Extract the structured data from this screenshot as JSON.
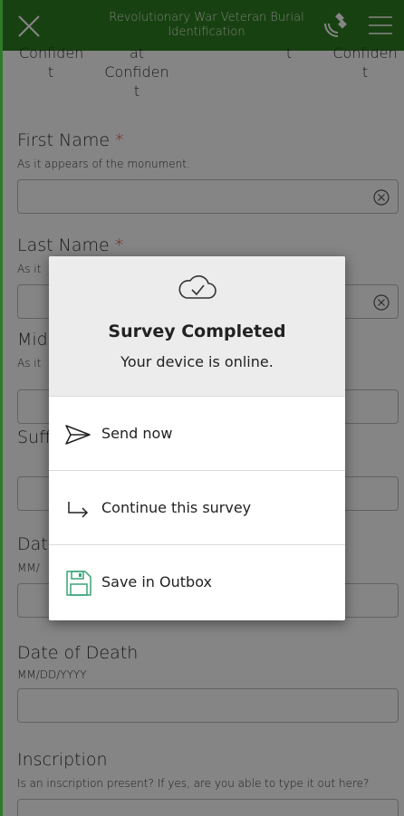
{
  "header": {
    "title_line1": "Revolutionary War Veteran Burial",
    "title_line2": "Identification"
  },
  "form": {
    "choices": {
      "c1_line1": "Confiden",
      "c1_line2": "t",
      "c2_line1": "at",
      "c2_line2": "Confiden",
      "c2_line3": "t",
      "c3_line1": "t",
      "c4_line1": "Confiden",
      "c4_line2": "t"
    },
    "required_mark": "*",
    "first_name": {
      "label": "First Name",
      "hint": "As it appears of the monument."
    },
    "last_name": {
      "label": "Last Name",
      "hint": "As it"
    },
    "middle_name": {
      "label": "Mid",
      "hint": "As it"
    },
    "suffix": {
      "label": "Suff"
    },
    "date_of_birth": {
      "label": "Dat",
      "hint": "MM/"
    },
    "date_of_death": {
      "label": "Date of Death",
      "hint": "MM/DD/YYYY"
    },
    "inscription": {
      "label": "Inscription",
      "hint": "Is an inscription present? If yes, are you able to type it out here?"
    }
  },
  "dialog": {
    "title": "Survey Completed",
    "subtitle": "Your device is online.",
    "options": {
      "send_now": "Send now",
      "continue": "Continue this survey",
      "save_outbox": "Save in Outbox"
    }
  },
  "colors": {
    "header_green": "#2e7d22",
    "accent_teal": "#3aa27a",
    "required_red": "#dd2222"
  }
}
